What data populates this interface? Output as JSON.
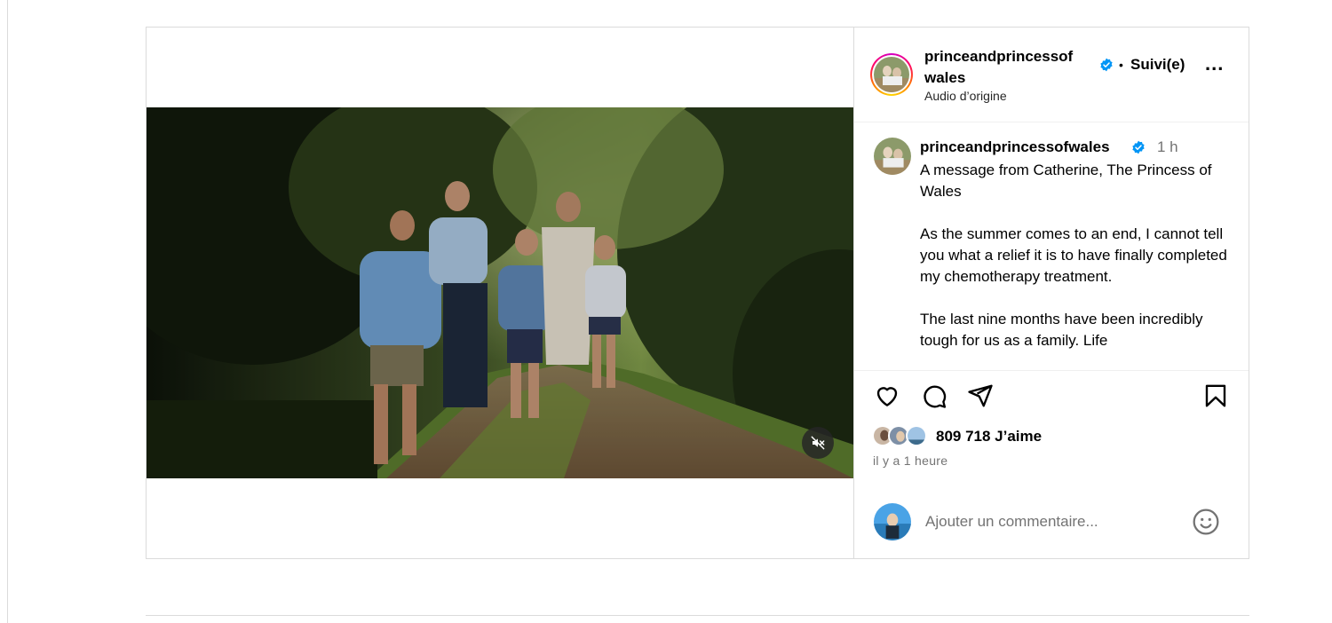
{
  "post": {
    "username_line1": "princeandprincessof",
    "username_line2": "wales",
    "follow_status": "Suivi(e)",
    "separator": "•",
    "more": "...",
    "audio": "Audio d’origine",
    "video_muted": true
  },
  "caption": {
    "username": "princeandprincessofwales",
    "time": "1 h",
    "paragraphs": [
      "A message from Catherine, The Princess of Wales",
      "As the summer comes to an end, I cannot tell you what a relief it is to have finally completed my chemotherapy treatment.",
      "The last nine months have been incredibly tough for us as a family. Life"
    ]
  },
  "engagement": {
    "likes": "809 718 J’aime",
    "posted": "il y a 1 heure"
  },
  "comment": {
    "placeholder": "Ajouter un commentaire..."
  },
  "colors": {
    "verified": "#0095f6",
    "border": "#dbdbdb",
    "muted_text": "#737373"
  },
  "icons": [
    "heart-icon",
    "comment-icon",
    "share-icon",
    "bookmark-icon",
    "mute-icon",
    "emoji-icon",
    "verified-icon",
    "more-icon"
  ]
}
